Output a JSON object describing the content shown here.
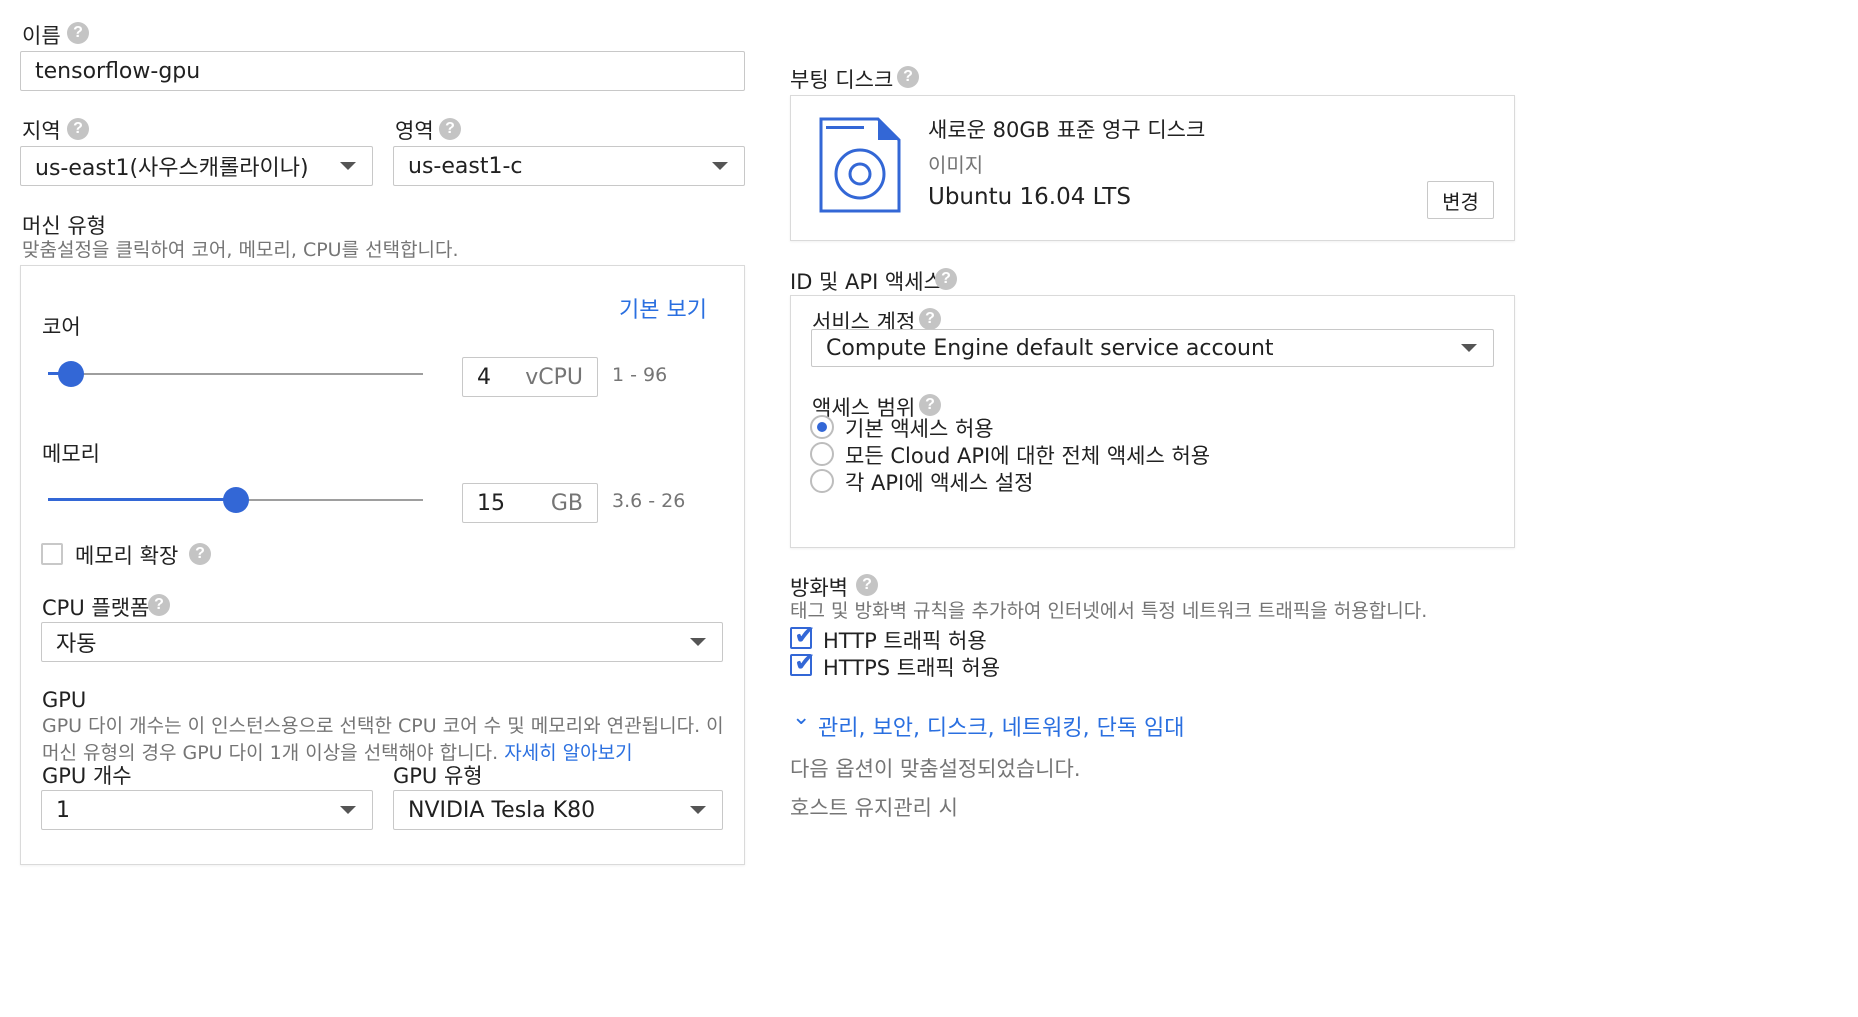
{
  "name": {
    "label": "이름",
    "value": "tensorflow-gpu"
  },
  "region": {
    "label": "지역",
    "value": "us-east1(사우스캐롤라이나)"
  },
  "zone": {
    "label": "영역",
    "value": "us-east1-c"
  },
  "machine_type": {
    "label": "머신 유형",
    "hint": "맞춤설정을 클릭하여 코어, 메모리, CPU를 선택합니다.",
    "basic_view_link": "기본 보기",
    "cores": {
      "label": "코어",
      "value": "4",
      "unit": "vCPU",
      "range": "1 - 96",
      "slider_fraction": 0.06
    },
    "memory": {
      "label": "메모리",
      "value": "15",
      "unit": "GB",
      "range": "3.6 - 26",
      "slider_fraction": 0.5
    },
    "extend_memory": {
      "label": "메모리 확장",
      "checked": false
    },
    "cpu_platform": {
      "label": "CPU 플랫폼",
      "value": "자동"
    },
    "gpu": {
      "label": "GPU",
      "description_line1": "GPU 다이 개수는 이 인스턴스용으로 선택한 CPU 코어 수 및 메모리와 연관됩니다. 이",
      "description_line2": "머신 유형의 경우 GPU 다이 1개 이상을 선택해야 합니다.",
      "learn_more": "자세히 알아보기",
      "count_label": "GPU 개수",
      "count_value": "1",
      "type_label": "GPU 유형",
      "type_value": "NVIDIA Tesla K80"
    }
  },
  "boot_disk": {
    "label": "부팅 디스크",
    "title": "새로운 80GB 표준 영구 디스크",
    "image_label": "이미지",
    "image_value": "Ubuntu 16.04 LTS",
    "change_button": "변경"
  },
  "identity": {
    "label": "ID 및 API 액세스",
    "service_account_label": "서비스 계정",
    "service_account_value": "Compute Engine default service account",
    "scope_label": "액세스 범위",
    "scope_options": [
      {
        "label": "기본 액세스 허용",
        "selected": true
      },
      {
        "label": "모든 Cloud API에 대한 전체 액세스 허용",
        "selected": false
      },
      {
        "label": "각 API에 액세스 설정",
        "selected": false
      }
    ]
  },
  "firewall": {
    "label": "방화벽",
    "hint": "태그 및 방화벽 규칙을 추가하여 인터넷에서 특정 네트워크 트래픽을 허용합니다.",
    "options": [
      {
        "label": "HTTP 트래픽 허용",
        "checked": true
      },
      {
        "label": "HTTPS 트래픽 허용",
        "checked": true
      }
    ]
  },
  "advanced": {
    "link": "관리, 보안, 디스크, 네트워킹, 단독 임대",
    "customized_note": "다음 옵션이 맞춤설정되었습니다.",
    "host_maintenance": "호스트 유지관리 시"
  },
  "icons": {
    "help": "?",
    "checkmark": "✔",
    "chevron": "⌄"
  },
  "colors": {
    "accent": "#3367d6",
    "link": "#2a6fe0",
    "border": "#c8c8c8"
  }
}
